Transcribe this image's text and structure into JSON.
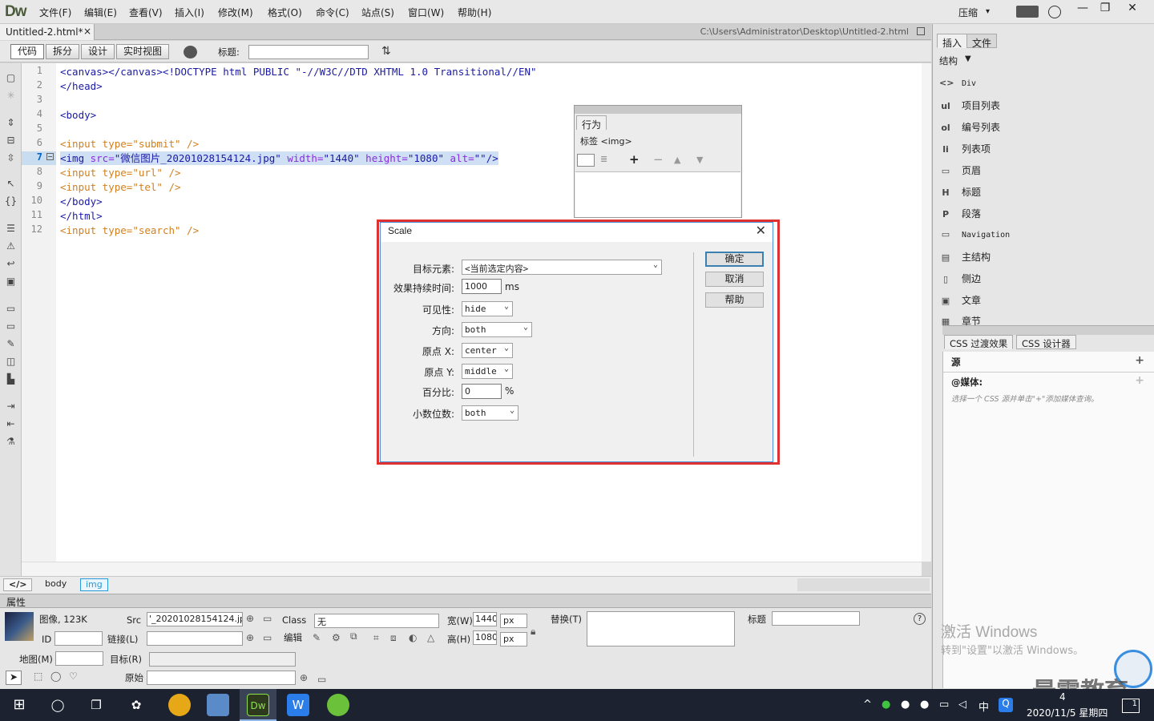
{
  "app": {
    "logo": "Dw"
  },
  "menubar": {
    "items": [
      "文件(F)",
      "编辑(E)",
      "查看(V)",
      "插入(I)",
      "修改(M)",
      "格式(O)",
      "命令(C)",
      "站点(S)",
      "窗口(W)",
      "帮助(H)"
    ],
    "compress_label": "压缩",
    "compress_arrow": "▾",
    "minimize": "—",
    "restore": "❐",
    "close": "✕"
  },
  "document": {
    "tab_name": "Untitled-2.html*",
    "tab_close": "×",
    "path": "C:\\Users\\Administrator\\Desktop\\Untitled-2.html"
  },
  "view_toolbar": {
    "code": "代码",
    "split": "拆分",
    "design": "设计",
    "live": "实时视图",
    "title_label": "标题:",
    "title_value": ""
  },
  "code": {
    "line_numbers": [
      "1",
      "2",
      "3",
      "4",
      "5",
      "6",
      "7",
      "8",
      "9",
      "10",
      "11",
      "12"
    ],
    "current_line": "7",
    "lines": {
      "l1": "<canvas></canvas><!DOCTYPE html PUBLIC \"-//W3C//DTD XHTML 1.0 Transitional//EN\"",
      "l2": "</head>",
      "l4": "<body>",
      "l6_tag": "<input",
      "l6_attr": " type=",
      "l6_val": "\"submit\"",
      "l6_end": " />",
      "l7_tag": "<img",
      "l7_a1": " src=",
      "l7_v1": "\"微信图片_20201028154124.jpg\"",
      "l7_a2": " width=",
      "l7_v2": "\"1440\"",
      "l7_a3": " height=",
      "l7_v3": "\"1080\"",
      "l7_a4": " alt=",
      "l7_v4": "\"\"",
      "l7_end": "/>",
      "l8_tag": "<input",
      "l8_attr": " type=",
      "l8_val": "\"url\"",
      "l8_end": " />",
      "l9_tag": "<input",
      "l9_attr": " type=",
      "l9_val": "\"tel\"",
      "l9_end": " />",
      "l10": "</body>",
      "l11": "</html>",
      "l12_tag": "<input",
      "l12_attr": " type=",
      "l12_val": "\"search\"",
      "l12_end": " />"
    }
  },
  "statusbar": {
    "code_icon": "</>",
    "body": "body",
    "img": "img"
  },
  "behaviors_panel": {
    "tab": "行为",
    "tag_label": "标签 <img>",
    "add": "+",
    "remove": "−",
    "up": "▲",
    "down": "▼"
  },
  "dialog": {
    "title": "Scale",
    "close": "✕",
    "target_label": "目标元素:",
    "target_value": "<当前选定内容>",
    "duration_label": "效果持续时间:",
    "duration_value": "1000",
    "duration_unit": "ms",
    "visibility_label": "可见性:",
    "visibility_value": "hide",
    "direction_label": "方向:",
    "direction_value": "both",
    "originx_label": "原点 X:",
    "originx_value": "center",
    "originy_label": "原点 Y:",
    "originy_value": "middle",
    "percent_label": "百分比:",
    "percent_value": "0",
    "percent_unit": "%",
    "scale_label": "小数位数:",
    "scale_value": "both",
    "ok": "确定",
    "cancel": "取消",
    "help": "帮助",
    "arrow": "⌄"
  },
  "properties": {
    "header": "属性",
    "type_label": "图像, 123K",
    "id_label": "ID",
    "src_label": "Src",
    "src_value": "'_20201028154124.jpg",
    "link_label": "链接(L)",
    "class_label": "Class",
    "class_value": "无",
    "edit_label": "编辑",
    "width_label": "宽(W)",
    "width_value": "1440",
    "height_label": "高(H)",
    "height_value": "1080",
    "unit": "px",
    "alt_label": "替换(T)",
    "title_label": "标题",
    "map_label": "地图(M)",
    "target_label": "目标(R)",
    "original_label": "原始",
    "help": "?"
  },
  "right_panel": {
    "tab_insert": "插入",
    "tab_files": "文件",
    "category": "结构",
    "category_arrow": "▼",
    "items": [
      {
        "icon": "<>",
        "label": "Div"
      },
      {
        "icon": "ul",
        "label": "项目列表"
      },
      {
        "icon": "ol",
        "label": "编号列表"
      },
      {
        "icon": "li",
        "label": "列表项"
      },
      {
        "icon": "▭",
        "label": "页眉"
      },
      {
        "icon": "H",
        "label": "标题"
      },
      {
        "icon": "P",
        "label": "段落"
      },
      {
        "icon": "▭",
        "label": "Navigation"
      },
      {
        "icon": "▤",
        "label": "主结构"
      },
      {
        "icon": "▯",
        "label": "侧边"
      },
      {
        "icon": "▣",
        "label": "文章"
      },
      {
        "icon": "▦",
        "label": "章节"
      }
    ],
    "css_tab1": "CSS 过渡效果",
    "css_tab2": "CSS 设计器",
    "source_label": "源",
    "media_label": "@媒体:",
    "media_hint": "选择一个 CSS 源并单击\"+\"添加媒体查询。",
    "plus": "+"
  },
  "watermark": {
    "line1": "激活 Windows",
    "line2": "转到\"设置\"以激活 Windows。",
    "brand": "最需教育"
  },
  "taskbar": {
    "time": "4",
    "date": "2020/11/5 星期四",
    "ime": "中",
    "notify": "1"
  }
}
